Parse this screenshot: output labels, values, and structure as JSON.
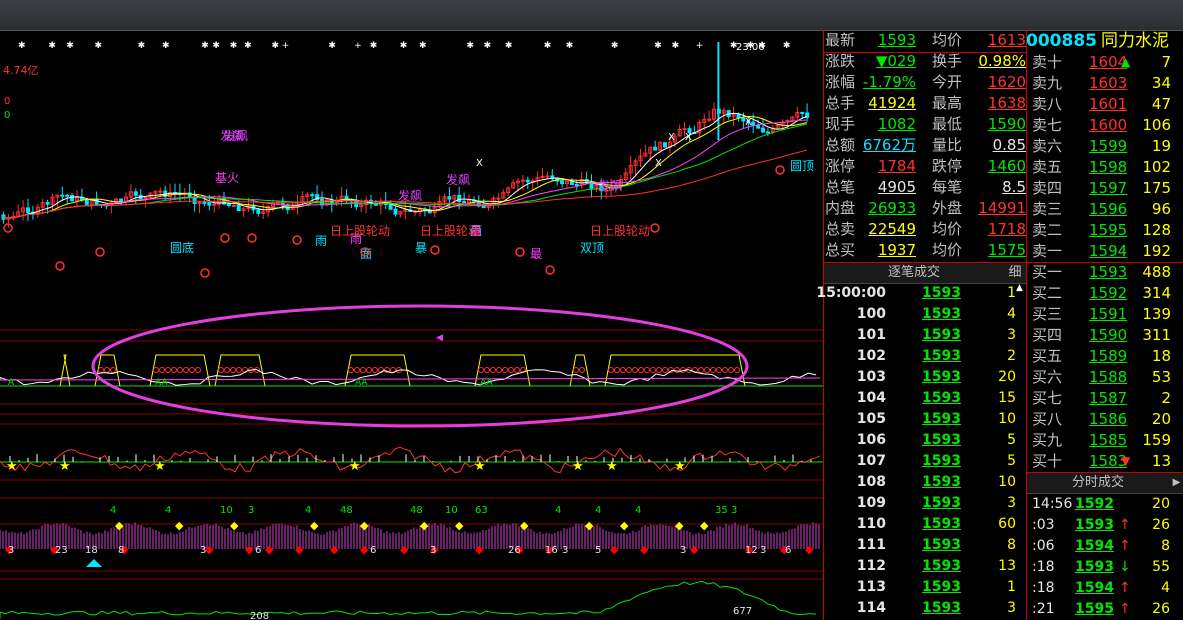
{
  "chart": {
    "turnover_label": "4.74亿",
    "peak_label": "23.06",
    "left_top_values": [
      "0",
      "0"
    ],
    "labels_purple": [
      "发飙",
      "发飙",
      "发飙",
      "发飙",
      "发飙"
    ],
    "labels_mixed": [
      "基火",
      "圆底",
      "雨",
      "雨",
      "雨",
      "暴",
      "最",
      "双顶",
      "面",
      "量",
      "圆顶"
    ],
    "tab_labels_red": [
      "日上股轮动",
      "日上股轮动",
      "日上股轮动"
    ],
    "indicator2_labels": [
      "A",
      "AA",
      "AA",
      "AA"
    ],
    "indicator4_numbers_top": [
      "4",
      "4",
      "10",
      "3",
      "4",
      "48",
      "48",
      "10",
      "63",
      "4",
      "4",
      "4",
      "35",
      "3"
    ],
    "indicator4_numbers_bottom": [
      "3",
      "23",
      "18",
      "8",
      "3",
      "6",
      "6",
      "3",
      "26",
      "16",
      "3",
      "5",
      "3",
      "12",
      "3",
      "6"
    ],
    "indicator5_labels": [
      "208",
      "677"
    ],
    "colors": {
      "up": "#ff3030",
      "down": "#00e5ff",
      "ma_white": "#ffffff",
      "ma_yellow": "#ffff00",
      "ma_magenta": "#ff40ff",
      "ma_green": "#00e600",
      "ellipse": "#e040e0"
    }
  },
  "quote": {
    "rows": [
      {
        "l1": "最新",
        "v1": "1593",
        "c1": "green",
        "l2": "均价",
        "v2": "1613",
        "c2": "red"
      },
      {
        "l1": "涨跌",
        "v1": "▼029",
        "c1": "green",
        "l2": "换手",
        "v2": "0.98%",
        "c2": "yellow"
      },
      {
        "l1": "涨幅",
        "v1": "-1.79%",
        "c1": "green",
        "l2": "今开",
        "v2": "1620",
        "c2": "red"
      },
      {
        "l1": "总手",
        "v1": "41924",
        "c1": "yellow",
        "l2": "最高",
        "v2": "1638",
        "c2": "red"
      },
      {
        "l1": "现手",
        "v1": "1082",
        "c1": "green",
        "l2": "最低",
        "v2": "1590",
        "c2": "green"
      },
      {
        "l1": "总额",
        "v1": "6762万",
        "c1": "cyan",
        "l2": "量比",
        "v2": "0.85",
        "c2": "white"
      },
      {
        "l1": "涨停",
        "v1": "1784",
        "c1": "red",
        "l2": "跌停",
        "v2": "1460",
        "c2": "green"
      },
      {
        "l1": "总笔",
        "v1": "4905",
        "c1": "white",
        "l2": "每笔",
        "v2": "8.5",
        "c2": "white"
      },
      {
        "l1": "内盘",
        "v1": "26933",
        "c1": "green",
        "l2": "外盘",
        "v2": "14991",
        "c2": "red"
      },
      {
        "l1": "总卖",
        "v1": "22549",
        "c1": "yellow",
        "l2": "均价",
        "v2": "1718",
        "c2": "red"
      },
      {
        "l1": "总买",
        "v1": "1937",
        "c1": "yellow",
        "l2": "均价",
        "v2": "1575",
        "c2": "green"
      }
    ]
  },
  "stock": {
    "code": "000885",
    "name": "同力水泥"
  },
  "order_book": {
    "sells": [
      {
        "label": "卖十",
        "price": "1604",
        "color": "red",
        "qty": "7",
        "arrow": "▲"
      },
      {
        "label": "卖九",
        "price": "1603",
        "color": "red",
        "qty": "34",
        "arrow": ""
      },
      {
        "label": "卖八",
        "price": "1601",
        "color": "red",
        "qty": "47",
        "arrow": ""
      },
      {
        "label": "卖七",
        "price": "1600",
        "color": "red",
        "qty": "106",
        "arrow": ""
      },
      {
        "label": "卖六",
        "price": "1599",
        "color": "green",
        "qty": "19",
        "arrow": ""
      },
      {
        "label": "卖五",
        "price": "1598",
        "color": "green",
        "qty": "102",
        "arrow": ""
      },
      {
        "label": "卖四",
        "price": "1597",
        "color": "green",
        "qty": "175",
        "arrow": ""
      },
      {
        "label": "卖三",
        "price": "1596",
        "color": "green",
        "qty": "96",
        "arrow": ""
      },
      {
        "label": "卖二",
        "price": "1595",
        "color": "green",
        "qty": "128",
        "arrow": ""
      },
      {
        "label": "卖一",
        "price": "1594",
        "color": "green",
        "qty": "192",
        "arrow": ""
      }
    ],
    "buys": [
      {
        "label": "买一",
        "price": "1593",
        "color": "green",
        "qty": "488",
        "arrow": ""
      },
      {
        "label": "买二",
        "price": "1592",
        "color": "green",
        "qty": "314",
        "arrow": ""
      },
      {
        "label": "买三",
        "price": "1591",
        "color": "green",
        "qty": "139",
        "arrow": ""
      },
      {
        "label": "买四",
        "price": "1590",
        "color": "green",
        "qty": "311",
        "arrow": ""
      },
      {
        "label": "买五",
        "price": "1589",
        "color": "green",
        "qty": "18",
        "arrow": ""
      },
      {
        "label": "买六",
        "price": "1588",
        "color": "green",
        "qty": "53",
        "arrow": ""
      },
      {
        "label": "买七",
        "price": "1587",
        "color": "green",
        "qty": "2",
        "arrow": ""
      },
      {
        "label": "买八",
        "price": "1586",
        "color": "green",
        "qty": "20",
        "arrow": ""
      },
      {
        "label": "买九",
        "price": "1585",
        "color": "green",
        "qty": "159",
        "arrow": ""
      },
      {
        "label": "买十",
        "price": "1583",
        "color": "green",
        "qty": "13",
        "arrow": "▼"
      }
    ]
  },
  "tick_panel": {
    "title": "逐笔成交",
    "tab": "细",
    "rows": [
      {
        "t": "15:00:00",
        "p": "1593",
        "v": "1"
      },
      {
        "t": "100",
        "p": "1593",
        "v": "4"
      },
      {
        "t": "101",
        "p": "1593",
        "v": "3"
      },
      {
        "t": "102",
        "p": "1593",
        "v": "2"
      },
      {
        "t": "103",
        "p": "1593",
        "v": "20"
      },
      {
        "t": "104",
        "p": "1593",
        "v": "15"
      },
      {
        "t": "105",
        "p": "1593",
        "v": "10"
      },
      {
        "t": "106",
        "p": "1593",
        "v": "5"
      },
      {
        "t": "107",
        "p": "1593",
        "v": "5"
      },
      {
        "t": "108",
        "p": "1593",
        "v": "10"
      },
      {
        "t": "109",
        "p": "1593",
        "v": "3"
      },
      {
        "t": "110",
        "p": "1593",
        "v": "60"
      },
      {
        "t": "111",
        "p": "1593",
        "v": "8"
      },
      {
        "t": "112",
        "p": "1593",
        "v": "13"
      },
      {
        "t": "113",
        "p": "1593",
        "v": "1"
      },
      {
        "t": "114",
        "p": "1593",
        "v": "3"
      }
    ]
  },
  "minute_panel": {
    "title": "分时成交",
    "rows": [
      {
        "t": "14:56",
        "p": "1592",
        "v": "20",
        "a": ""
      },
      {
        "t": ":03",
        "p": "1593",
        "v": "26",
        "a": "↑"
      },
      {
        "t": ":06",
        "p": "1594",
        "v": "8",
        "a": "↑"
      },
      {
        "t": ":18",
        "p": "1593",
        "v": "55",
        "a": "↓"
      },
      {
        "t": ":18",
        "p": "1594",
        "v": "4",
        "a": "↑"
      },
      {
        "t": ":21",
        "p": "1595",
        "v": "26",
        "a": "↑"
      }
    ]
  }
}
